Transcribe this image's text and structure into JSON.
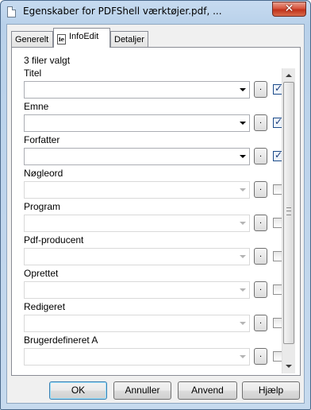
{
  "window": {
    "title": "Egenskaber for PDFShell værktøjer.pdf, ...",
    "close_glyph": "✕"
  },
  "tabs": [
    {
      "label": "Generelt",
      "active": false
    },
    {
      "label": "InfoEdit",
      "active": true,
      "icon": "ie-document-icon"
    },
    {
      "label": "Detaljer",
      "active": false
    }
  ],
  "panel": {
    "selected_count": "3 filer valgt",
    "dot_button_label": ".",
    "fields": [
      {
        "label": "Titel",
        "value": "",
        "enabled": true,
        "checked": true
      },
      {
        "label": "Emne",
        "value": "",
        "enabled": true,
        "checked": true
      },
      {
        "label": "Forfatter",
        "value": "",
        "enabled": true,
        "checked": true
      },
      {
        "label": "Nøgleord",
        "value": "",
        "enabled": false,
        "checked": false
      },
      {
        "label": "Program",
        "value": "",
        "enabled": false,
        "checked": false
      },
      {
        "label": "Pdf-producent",
        "value": "",
        "enabled": false,
        "checked": false
      },
      {
        "label": "Oprettet",
        "value": "",
        "enabled": false,
        "checked": false
      },
      {
        "label": "Redigeret",
        "value": "",
        "enabled": false,
        "checked": false
      },
      {
        "label": "Brugerdefineret A",
        "value": "",
        "enabled": false,
        "checked": false
      }
    ]
  },
  "buttons": {
    "ok": "OK",
    "cancel": "Annuller",
    "apply": "Anvend",
    "help": "Hjælp"
  }
}
